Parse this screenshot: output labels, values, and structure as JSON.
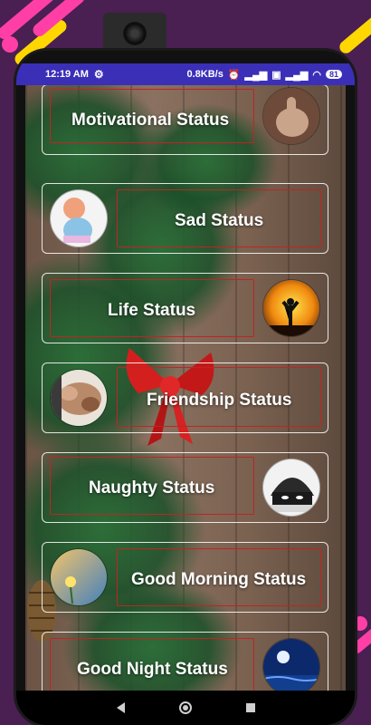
{
  "status_bar": {
    "time": "12:19 AM",
    "network_speed": "0.8KB/s",
    "battery": "81",
    "icons": [
      "gear-icon",
      "alarm-icon",
      "signal-icon",
      "signal-icon",
      "vpn-icon",
      "wifi-icon"
    ]
  },
  "categories": [
    {
      "label": "Motivational Status",
      "thumb": "thumbs-up-image",
      "thumb_side": "right"
    },
    {
      "label": "Sad Status",
      "thumb": "sad-girl-image",
      "thumb_side": "left"
    },
    {
      "label": "Life Status",
      "thumb": "sunset-silhouette-image",
      "thumb_side": "right"
    },
    {
      "label": "Friendship Status",
      "thumb": "friends-hands-image",
      "thumb_side": "left"
    },
    {
      "label": "Naughty Status",
      "thumb": "masked-boy-image",
      "thumb_side": "right"
    },
    {
      "label": "Good Morning Status",
      "thumb": "morning-flower-image",
      "thumb_side": "left"
    },
    {
      "label": "Good Night Status",
      "thumb": "night-sea-image",
      "thumb_side": "right"
    }
  ],
  "nav": {
    "back": "back-icon",
    "home": "home-icon",
    "recent": "recent-apps-icon"
  },
  "colors": {
    "status_bar": "#3b2fb8",
    "frame": "#c02424",
    "background": "#4a1f52"
  }
}
